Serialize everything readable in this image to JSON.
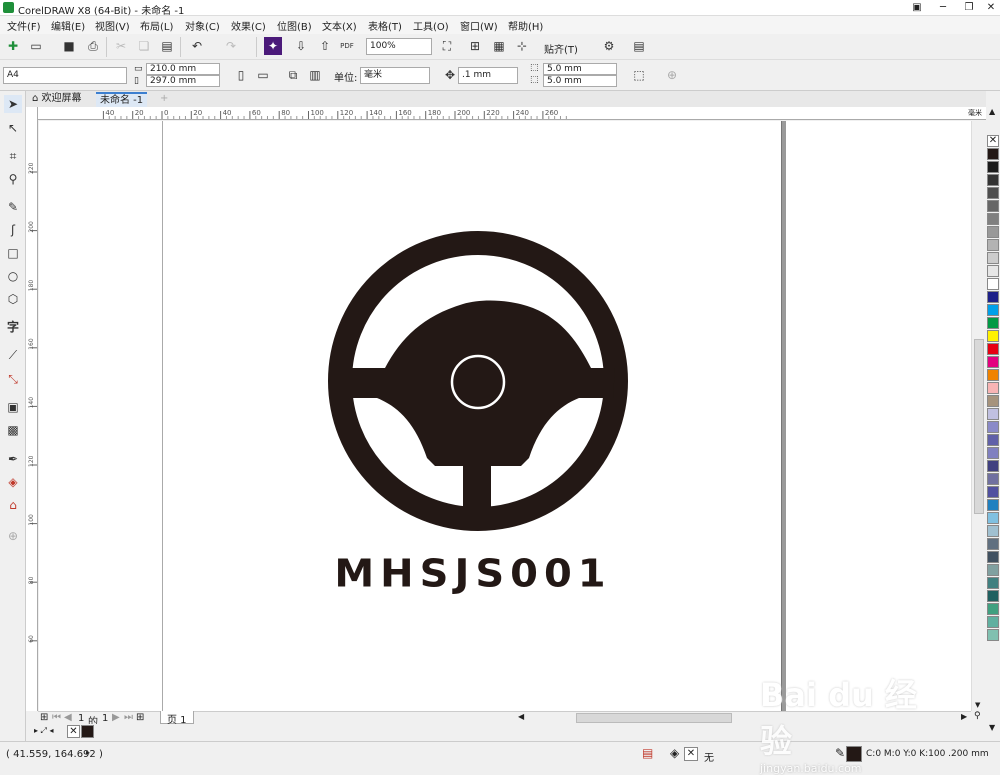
{
  "window": {
    "title": "CorelDRAW X8 (64-Bit) - 未命名 -1"
  },
  "menu": [
    "文件(F)",
    "编辑(E)",
    "视图(V)",
    "布局(L)",
    "对象(C)",
    "效果(C)",
    "位图(B)",
    "文本(X)",
    "表格(T)",
    "工具(O)",
    "窗口(W)",
    "帮助(H)"
  ],
  "toolbar": {
    "zoom": "100%",
    "snap_label": "贴齐(T)",
    "pdf_label": "PDF"
  },
  "propbar": {
    "page_size": "A4",
    "width": "210.0 mm",
    "height": "297.0 mm",
    "unit_label": "单位:",
    "unit": "毫米",
    "nudge": ".1 mm",
    "dup_x": "5.0 mm",
    "dup_y": "5.0 mm"
  },
  "tabs": {
    "welcome": "欢迎屏幕",
    "doc": "未命名 -1"
  },
  "ruler": {
    "h_ticks": [
      "40",
      "20",
      "0",
      "20",
      "40",
      "60",
      "80",
      "100",
      "120",
      "140",
      "160",
      "180",
      "200",
      "220",
      "240",
      "260"
    ],
    "v_ticks": [
      "220",
      "200",
      "180",
      "160",
      "140",
      "120",
      "100",
      "80",
      "60"
    ],
    "unit": "毫米"
  },
  "artwork": {
    "text": "MHSJS001",
    "color": "#231815"
  },
  "pagenav": {
    "current": "1",
    "of": "的",
    "total": "1",
    "tab": "页 1"
  },
  "palette": [
    "#231815",
    "#1a1a1a",
    "#333333",
    "#4d4d4d",
    "#666666",
    "#808080",
    "#999999",
    "#b3b3b3",
    "#cccccc",
    "#e6e6e6",
    "#ffffff",
    "#1d2088",
    "#00a0e9",
    "#009944",
    "#fff100",
    "#e60012",
    "#e4007f",
    "#f08300",
    "#f8b4b4",
    "#a6937c",
    "#c0c0e0",
    "#8a8ac8",
    "#6060a8",
    "#8080c0",
    "#404080",
    "#7070a0",
    "#5050a0",
    "#2080c0",
    "#80c0e0",
    "#a0c0d0",
    "#607080",
    "#405060",
    "#80a0a0",
    "#408080",
    "#206060",
    "#40a080",
    "#60b0a0",
    "#80c0b0"
  ],
  "status": {
    "coords": "( 41.559, 164.692 )",
    "fill_none": "无",
    "color_info": "C:0 M:0 Y:0 K:100  .200 mm"
  },
  "watermark": {
    "brand": "Bai du 经验",
    "url": "jingyan.baidu.com"
  }
}
